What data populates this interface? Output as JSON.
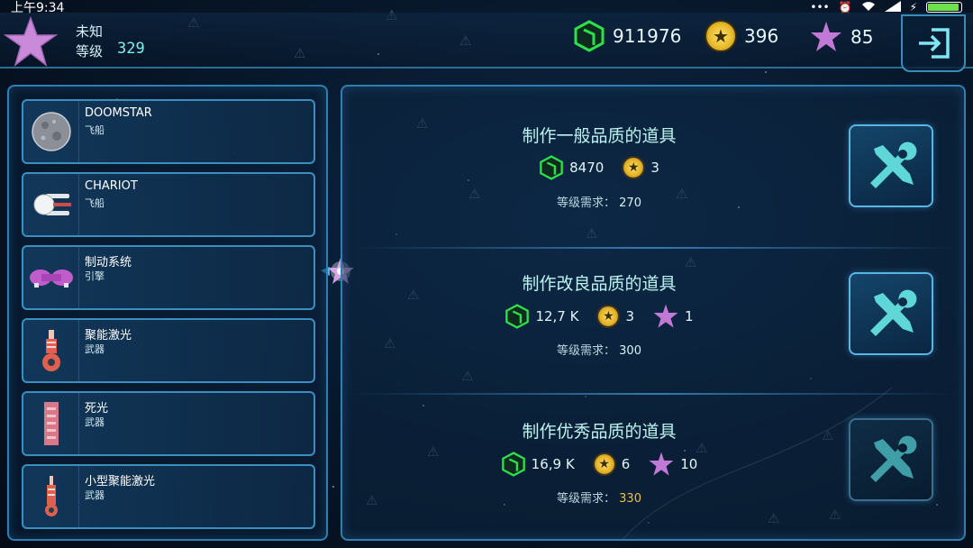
{
  "status_bar": {
    "time": "上午9:34",
    "dots": "•••",
    "battery_level": 0.95
  },
  "player": {
    "name": "未知",
    "level_label": "等级",
    "level": "329"
  },
  "currencies": {
    "cubes": "911976",
    "coins": "396",
    "stars": "85"
  },
  "items": [
    {
      "name": "DOOMSTAR",
      "type": "飞船",
      "icon": "doomstar-ship-icon"
    },
    {
      "name": "CHARIOT",
      "type": "飞船",
      "icon": "chariot-ship-icon"
    },
    {
      "name": "制动系统",
      "type": "引擎",
      "icon": "engine-icon"
    },
    {
      "name": "聚能激光",
      "type": "武器",
      "icon": "laser-weapon-icon"
    },
    {
      "name": "死光",
      "type": "武器",
      "icon": "deathray-weapon-icon"
    },
    {
      "name": "小型聚能激光",
      "type": "武器",
      "icon": "small-laser-weapon-icon"
    }
  ],
  "recipes": [
    {
      "title": "制作一般品质的道具",
      "cubes": "8470",
      "coins": "3",
      "requirement_label": "等级需求：",
      "requirement_level": "270"
    },
    {
      "title": "制作改良品质的道具",
      "cubes": "12,7 K",
      "coins": "3",
      "stars": "1",
      "requirement_label": "等级需求：",
      "requirement_level": "300"
    },
    {
      "title": "制作优秀品质的道具",
      "cubes": "16,9 K",
      "coins": "6",
      "stars": "10",
      "requirement_label": "等级需求：",
      "requirement_level": "330"
    }
  ],
  "colors": {
    "accent_cyan": "#7ff0e8",
    "panel_border": "#2f7fb3",
    "cube_green": "#2ee04c",
    "star_purple": "#c07ad6",
    "coin_gold": "#f2c43a",
    "unmet_requirement": "#e8c24a"
  },
  "icons": {
    "currency_cube": "green-cube-icon",
    "currency_coin": "gold-star-coin-icon",
    "currency_star": "purple-star-icon",
    "exit": "exit-door-icon",
    "craft": "wrench-screwdriver-icon"
  }
}
